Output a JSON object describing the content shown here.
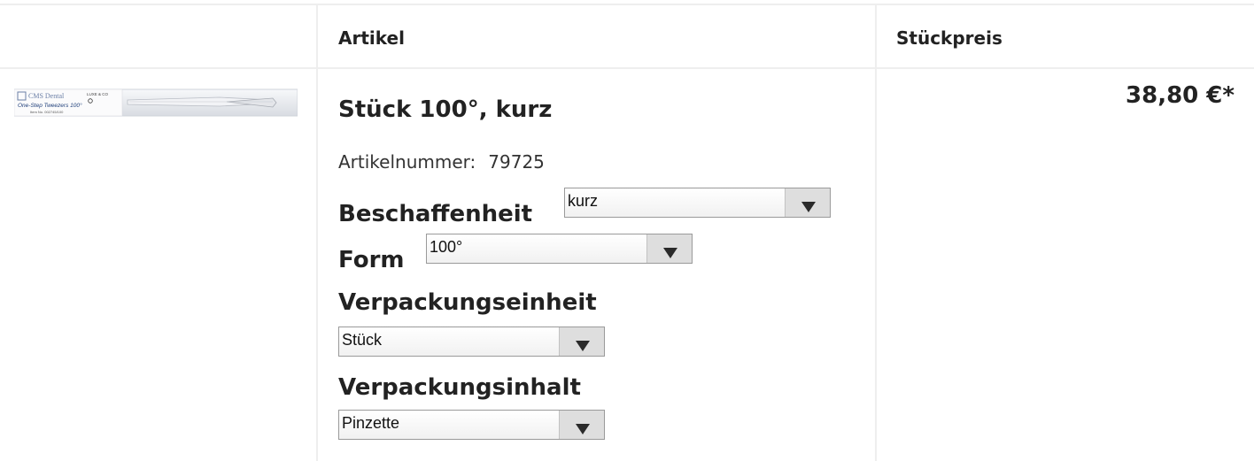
{
  "table": {
    "headers": {
      "article": "Artikel",
      "unit_price": "Stückpreis"
    }
  },
  "product": {
    "image_alt": "CMS Dental One-Step Tweezers 100°",
    "image_text": {
      "brand": "CMS Dental",
      "name": "One-Step Tweezers 100°",
      "item_no": "Item No. 002745/100",
      "corner": "LUXE & CO"
    },
    "title": "Stück 100°, kurz",
    "article_number_label": "Artikelnummer:",
    "article_number": "79725",
    "price": "38,80 €*",
    "options": [
      {
        "label": "Beschaffenheit",
        "value": "kurz"
      },
      {
        "label": "Form",
        "value": "100°"
      },
      {
        "label": "Verpackungseinheit",
        "value": "Stück"
      },
      {
        "label": "Verpackungsinhalt",
        "value": "Pinzette"
      }
    ]
  }
}
